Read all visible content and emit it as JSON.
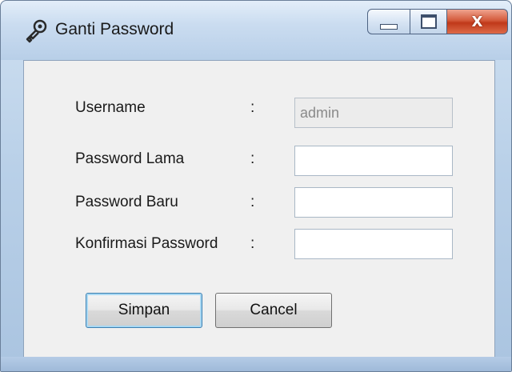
{
  "window": {
    "title": "Ganti Password",
    "icon": "wrench-key-icon",
    "controls": {
      "minimize": "minimize-icon",
      "maximize": "maximize-icon",
      "close": "close-icon",
      "close_glyph": "X"
    }
  },
  "form": {
    "separator": ":",
    "fields": [
      {
        "label": "Username",
        "value": "admin",
        "readonly": true
      },
      {
        "label": "Password Lama",
        "value": ""
      },
      {
        "label": "Password Baru",
        "value": ""
      },
      {
        "label": "Konfirmasi Password",
        "value": ""
      }
    ]
  },
  "buttons": {
    "save": "Simpan",
    "cancel": "Cancel"
  },
  "colors": {
    "close_button": "#c0391a",
    "default_button_border": "#3c7fb1",
    "content_bg": "#f0f0f0"
  }
}
